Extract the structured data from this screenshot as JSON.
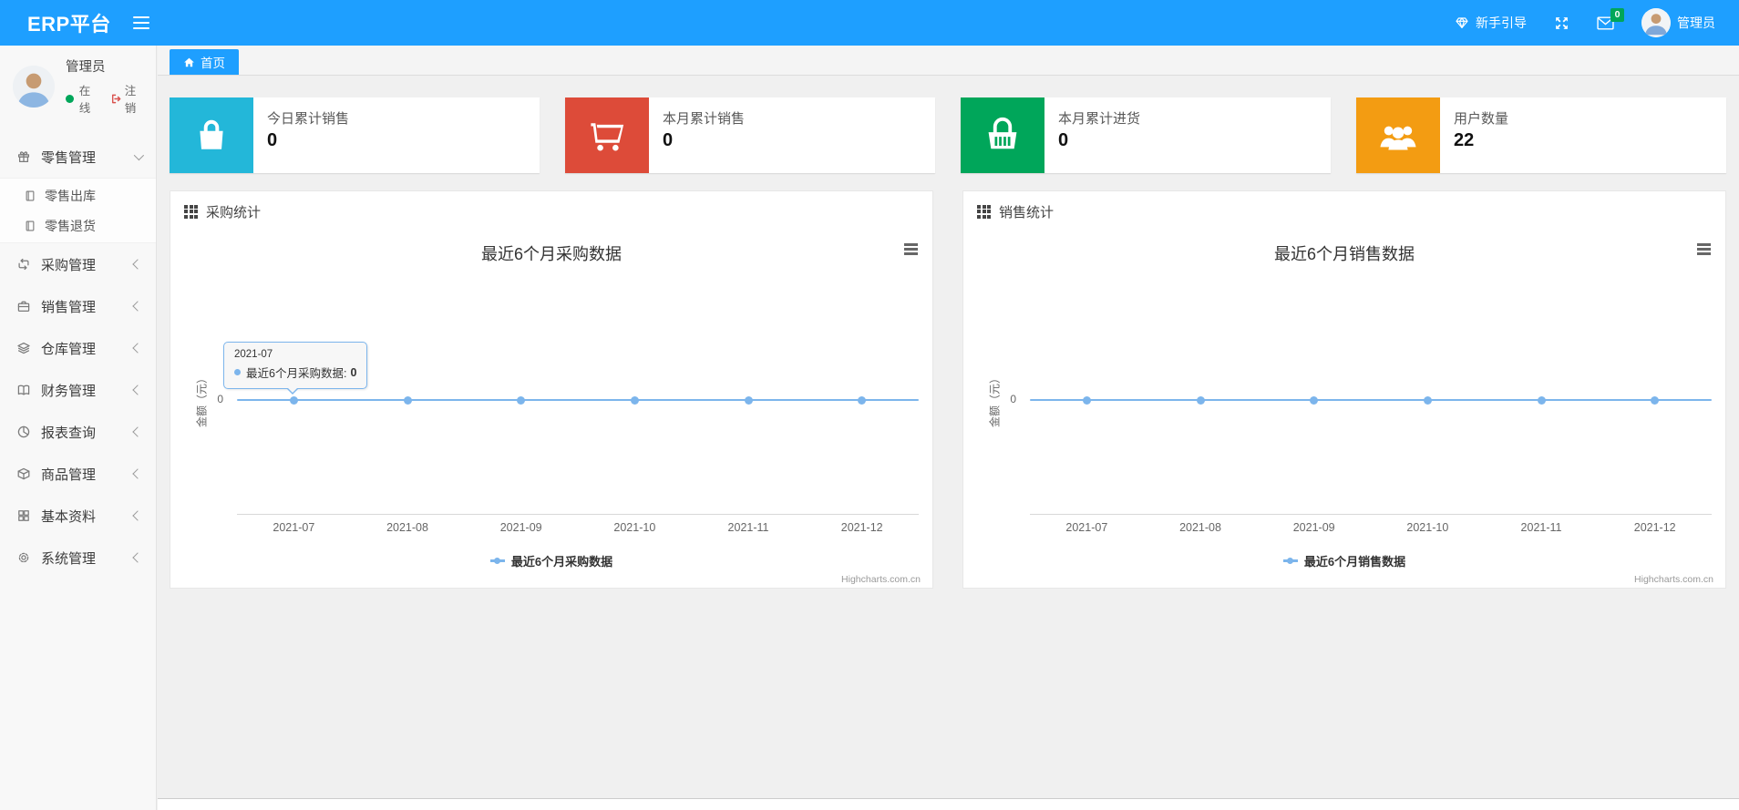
{
  "colors": {
    "header": "#1e9fff",
    "badge": "#00a65a",
    "series": "#7cb5ec"
  },
  "header": {
    "brand": "ERP平台",
    "nav": {
      "guide_label": "新手引导",
      "message_badge": "0",
      "username": "管理员"
    }
  },
  "sidebar": {
    "user": {
      "name": "管理员",
      "status_label": "在线",
      "logout_label": "注销"
    },
    "menu": [
      {
        "label": "零售管理",
        "icon": "gift-icon",
        "state": "expanded",
        "children": [
          {
            "label": "零售出库",
            "icon": "file-icon"
          },
          {
            "label": "零售退货",
            "icon": "file-icon"
          }
        ]
      },
      {
        "label": "采购管理",
        "icon": "loop-icon",
        "state": "collapsed"
      },
      {
        "label": "销售管理",
        "icon": "briefcase-icon",
        "state": "collapsed"
      },
      {
        "label": "仓库管理",
        "icon": "layers-icon",
        "state": "collapsed"
      },
      {
        "label": "财务管理",
        "icon": "book-icon",
        "state": "collapsed"
      },
      {
        "label": "报表查询",
        "icon": "pie-chart-icon",
        "state": "collapsed"
      },
      {
        "label": "商品管理",
        "icon": "cube-icon",
        "state": "collapsed"
      },
      {
        "label": "基本资料",
        "icon": "grid-icon",
        "state": "collapsed"
      },
      {
        "label": "系统管理",
        "icon": "gear-icon",
        "state": "collapsed"
      }
    ]
  },
  "tabs": {
    "home_label": "首页"
  },
  "stat_cards": [
    {
      "label": "今日累计销售",
      "value": "0",
      "color": "#23b7d9",
      "icon": "shopping-bag-icon"
    },
    {
      "label": "本月累计销售",
      "value": "0",
      "color": "#dd4b39",
      "icon": "shopping-cart-icon"
    },
    {
      "label": "本月累计进货",
      "value": "0",
      "color": "#00a65a",
      "icon": "shopping-basket-icon"
    },
    {
      "label": "用户数量",
      "value": "22",
      "color": "#f39c12",
      "icon": "users-icon"
    }
  ],
  "chart_data": [
    {
      "type": "line",
      "panel_title": "采购统计",
      "title": "最近6个月采购数据",
      "categories": [
        "2021-07",
        "2021-08",
        "2021-09",
        "2021-10",
        "2021-11",
        "2021-12"
      ],
      "series": [
        {
          "name": "最近6个月采购数据",
          "values": [
            0,
            0,
            0,
            0,
            0,
            0
          ],
          "color": "#7cb5ec"
        }
      ],
      "ylabel": "金额（元）",
      "y_tick": "0",
      "ylim": [
        0,
        1
      ],
      "grid": false,
      "legend_position": "bottom",
      "credits": "Highcharts.com.cn",
      "tooltip": {
        "header": "2021-07",
        "series": "最近6个月采购数据:",
        "value": "0"
      }
    },
    {
      "type": "line",
      "panel_title": "销售统计",
      "title": "最近6个月销售数据",
      "categories": [
        "2021-07",
        "2021-08",
        "2021-09",
        "2021-10",
        "2021-11",
        "2021-12"
      ],
      "series": [
        {
          "name": "最近6个月销售数据",
          "values": [
            0,
            0,
            0,
            0,
            0,
            0
          ],
          "color": "#7cb5ec"
        }
      ],
      "ylabel": "金额（元）",
      "y_tick": "0",
      "ylim": [
        0,
        1
      ],
      "grid": false,
      "legend_position": "bottom",
      "credits": "Highcharts.com.cn"
    }
  ]
}
